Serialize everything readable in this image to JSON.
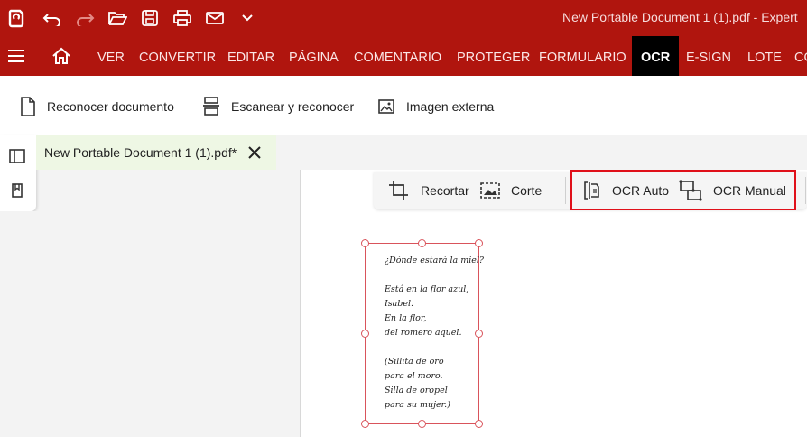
{
  "titlebar": {
    "title": "New Portable Document 1 (1).pdf  -  Expert"
  },
  "menu": {
    "tabs": [
      "VER",
      "CONVERTIR",
      "EDITAR",
      "PÁGINA",
      "COMENTARIO",
      "PROTEGER",
      "FORMULARIO",
      "OCR",
      "E-SIGN",
      "LOTE",
      "CO"
    ],
    "active": "OCR"
  },
  "ribbon": {
    "recognize_document": "Reconocer documento",
    "scan_recognize": "Escanear y reconocer",
    "external_image": "Imagen externa"
  },
  "document_tab": {
    "name": "New Portable Document 1 (1).pdf*"
  },
  "toolbar": {
    "crop": "Recortar",
    "cut": "Corte",
    "ocr_auto": "OCR Auto",
    "ocr_manual": "OCR Manual"
  },
  "poem": {
    "lines": [
      "¿Dónde estará la miel?",
      "",
      "Está en la flor azul,",
      "Isabel.",
      "En la flor,",
      "del romero aquel.",
      "",
      "(Sillita de oro",
      "para el moro.",
      "Silla de oropel",
      "para su mujer.)"
    ]
  },
  "colors": {
    "brand_red": "#b0150e",
    "active_tab": "#000000",
    "highlight": "#e0101a"
  }
}
